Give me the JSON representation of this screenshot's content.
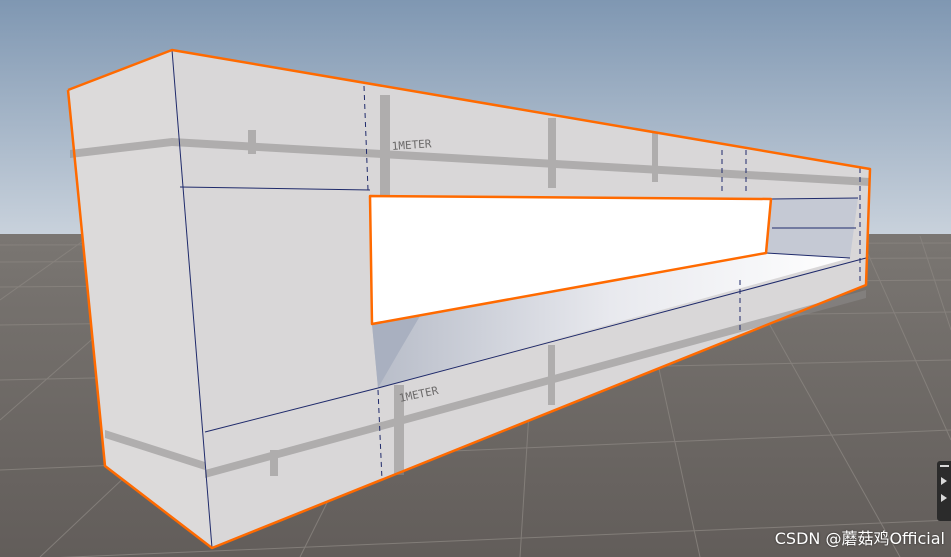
{
  "scene": {
    "watermark": "CSDN @蘑菇鸡Official",
    "texture_label": "1METER",
    "colors": {
      "sky_top": "#7f97b2",
      "sky_horizon": "#c5d0dc",
      "ground": "#6b6663",
      "grid_line": "#8a8580",
      "mesh_face": "#dad8d8",
      "mesh_shadow": "#b9b8bb",
      "selection_outline": "#ff6a00",
      "wireframe": "#1f2a6b",
      "hole_sky": "#ffffff"
    }
  },
  "overlay": {
    "icon": "scene-overlay-toggle-icon"
  }
}
